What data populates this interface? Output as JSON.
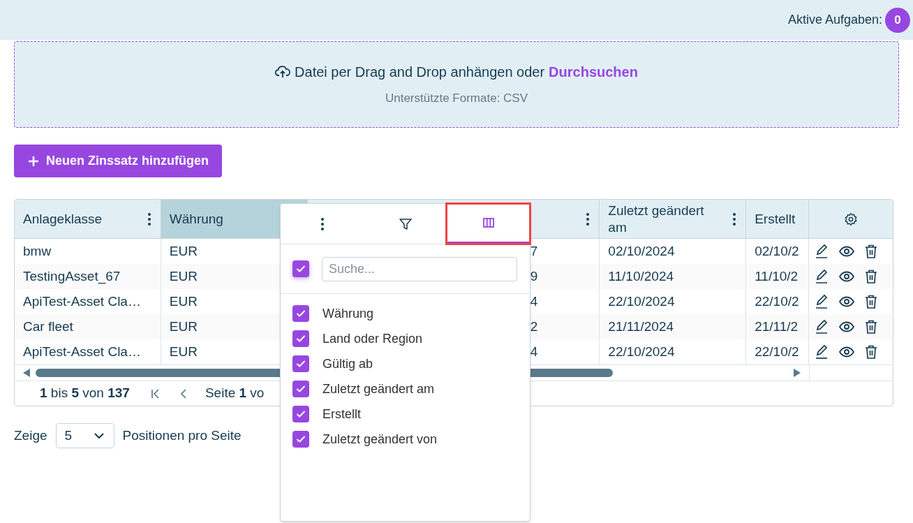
{
  "header": {
    "label": "Aktive Aufgaben:",
    "count": "0"
  },
  "upload": {
    "text": "Datei per Drag and Drop anhängen oder",
    "link": "Durchsuchen",
    "hint": "Unterstützte Formate: CSV"
  },
  "add_button": {
    "label": "Neuen Zinssatz hinzufügen"
  },
  "table": {
    "columns": [
      {
        "label": "Anlageklasse",
        "has_menu": true,
        "highlighted": false
      },
      {
        "label": "Währung",
        "has_menu": false,
        "highlighted": true
      },
      {
        "has_menu": true,
        "highlighted": false
      },
      {
        "label": "Zuletzt geändert am",
        "has_menu": true,
        "highlighted": false
      },
      {
        "label": "Erstellt",
        "has_menu": false,
        "highlighted": false
      }
    ],
    "rows": [
      [
        "bmw",
        "EUR",
        "7",
        "02/10/2024",
        "02/10/2"
      ],
      [
        "TestingAsset_67",
        "EUR",
        "9",
        "11/10/2024",
        "11/10/2"
      ],
      [
        "ApiTest-Asset Cla…",
        "EUR",
        "4",
        "22/10/2024",
        "22/10/2"
      ],
      [
        "Car fleet",
        "EUR",
        "2",
        "21/11/2024",
        "21/11/2"
      ],
      [
        "ApiTest-Asset Cla…",
        "EUR",
        "4",
        "22/10/2024",
        "22/10/2"
      ]
    ],
    "summary": "**1** bis **5** von **137**",
    "page": "Seite **1** vo"
  },
  "page_size": {
    "label": "Zeige",
    "value": "5",
    "suffix": "Positionen pro Seite"
  },
  "column_menu": {
    "tabs": [
      {
        "kind": "menu",
        "selected": false,
        "highlighted": false
      },
      {
        "kind": "filter",
        "selected": false,
        "highlighted": false
      },
      {
        "kind": "columns",
        "selected": true,
        "highlighted": true
      }
    ],
    "select_all": {
      "checked": true
    },
    "search": {
      "placeholder": "Suche..."
    },
    "items": [
      {
        "label": "Währung",
        "checked": true
      },
      {
        "label": "Land oder Region",
        "checked": true
      },
      {
        "label": "Gültig ab",
        "checked": true
      },
      {
        "label": "Zuletzt geändert am",
        "checked": true
      },
      {
        "label": "Erstellt",
        "checked": true
      },
      {
        "label": "Zuletzt geändert von",
        "checked": true
      }
    ]
  }
}
